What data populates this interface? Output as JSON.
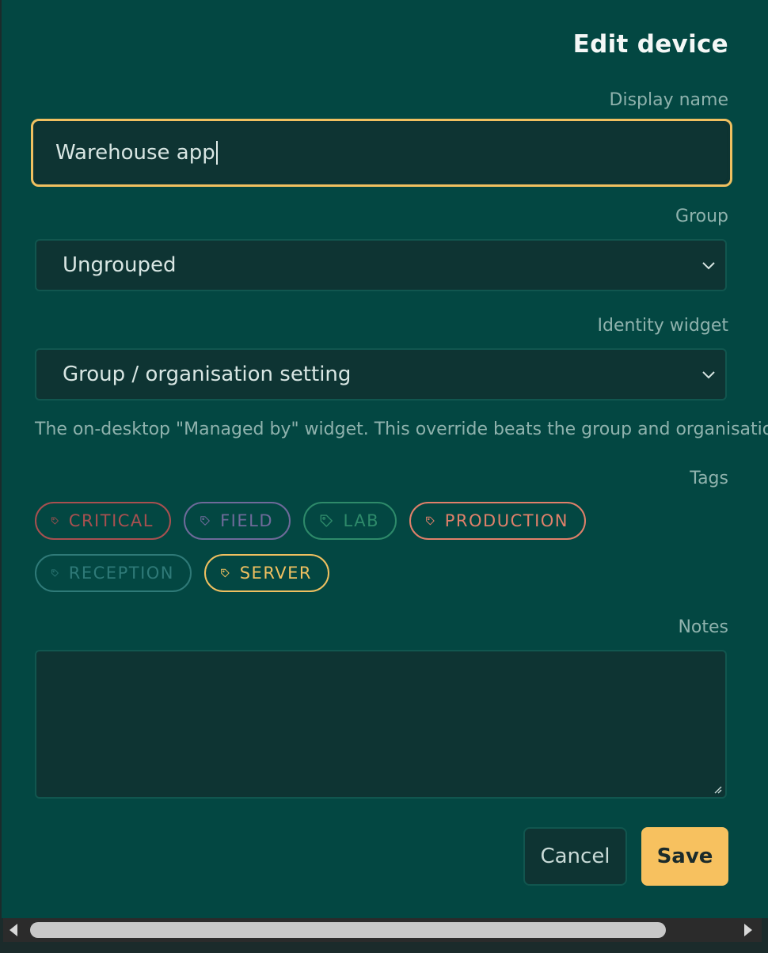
{
  "dialog": {
    "title": "Edit device",
    "display_name": {
      "label": "Display name",
      "value": "Warehouse app"
    },
    "group": {
      "label": "Group",
      "selected": "Ungrouped"
    },
    "identity_widget": {
      "label": "Identity widget",
      "selected": "Group / organisation setting",
      "help": "The on-desktop \"Managed by\" widget. This override beats the group and organisation"
    },
    "tags": {
      "label": "Tags",
      "items": [
        {
          "label": "CRITICAL",
          "color": "#a85050"
        },
        {
          "label": "FIELD",
          "color": "#6e6a9a"
        },
        {
          "label": "LAB",
          "color": "#2e8a6a"
        },
        {
          "label": "PRODUCTION",
          "color": "#e0806a"
        },
        {
          "label": "RECEPTION",
          "color": "#2f7a78"
        },
        {
          "label": "SERVER",
          "color": "#f0c060"
        }
      ]
    },
    "notes": {
      "label": "Notes",
      "value": ""
    },
    "buttons": {
      "cancel": "Cancel",
      "save": "Save"
    }
  },
  "colors": {
    "background": "#034742",
    "field": "#0e3433",
    "accent": "#f7c15f"
  }
}
